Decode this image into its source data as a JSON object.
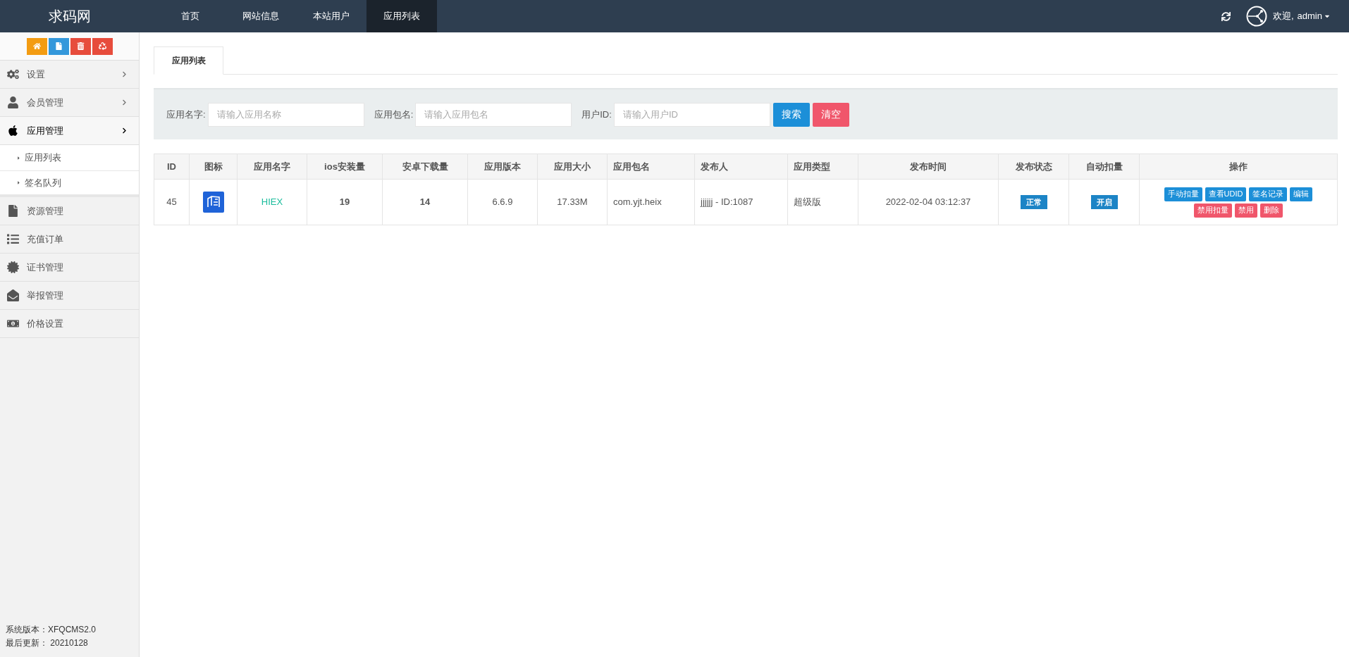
{
  "brand": "求码网",
  "nav": [
    {
      "label": "首页",
      "selected": false
    },
    {
      "label": "网站信息",
      "selected": false
    },
    {
      "label": "本站用户",
      "selected": false
    },
    {
      "label": "应用列表",
      "selected": true
    }
  ],
  "user": {
    "greeting": "欢迎,",
    "name": "admin"
  },
  "quick_buttons": [
    {
      "color": "#f39c12"
    },
    {
      "color": "#3498db"
    },
    {
      "color": "#e74c3c"
    },
    {
      "color": "#e74c3c"
    }
  ],
  "sidebar": {
    "items": [
      {
        "label": "设置",
        "expanded": false
      },
      {
        "label": "会员管理",
        "expanded": false
      },
      {
        "label": "应用管理",
        "expanded": true,
        "children": [
          {
            "label": "应用列表"
          },
          {
            "label": "签名队列"
          }
        ]
      },
      {
        "label": "资源管理"
      },
      {
        "label": "充值订单"
      },
      {
        "label": "证书管理"
      },
      {
        "label": "举报管理"
      },
      {
        "label": "价格设置"
      }
    ],
    "footer": [
      "系统版本：XFQCMS2.0",
      "最后更新： 20210128"
    ]
  },
  "tabs": [
    {
      "label": "应用列表",
      "selected": true
    }
  ],
  "search": {
    "fields": [
      {
        "label": "应用名字:",
        "placeholder": "请输入应用名称"
      },
      {
        "label": "应用包名:",
        "placeholder": "请输入应用包名"
      },
      {
        "label": "用户ID:",
        "placeholder": "请输入用户ID"
      }
    ],
    "buttons": [
      {
        "label": "搜索",
        "kind": "primary"
      },
      {
        "label": "清空",
        "kind": "danger"
      }
    ]
  },
  "table": {
    "columns": [
      "ID",
      "图标",
      "应用名字",
      "ios安装量",
      "安卓下载量",
      "应用版本",
      "应用大小",
      "应用包名",
      "发布人",
      "应用类型",
      "发布时间",
      "发布状态",
      "自动扣量",
      "操作"
    ],
    "rows": [
      {
        "id": "45",
        "name": "HIEX",
        "ios": "19",
        "android": "14",
        "version": "6.6.9",
        "size": "17.33M",
        "package": "com.yjt.heix",
        "publisher": "jjjjjj - ID:1087",
        "type": "超级版",
        "time": "2022-02-04 03:12:37",
        "status": "正常",
        "auto": "开启",
        "actions": [
          {
            "label": "手动扣量",
            "kind": "primary"
          },
          {
            "label": "查看UDID",
            "kind": "primary"
          },
          {
            "label": "签名记录",
            "kind": "primary"
          },
          {
            "label": "编辑",
            "kind": "primary"
          },
          {
            "label": "禁用扣量",
            "kind": "danger"
          },
          {
            "label": "禁用",
            "kind": "danger"
          },
          {
            "label": "删除",
            "kind": "danger"
          }
        ]
      }
    ]
  }
}
